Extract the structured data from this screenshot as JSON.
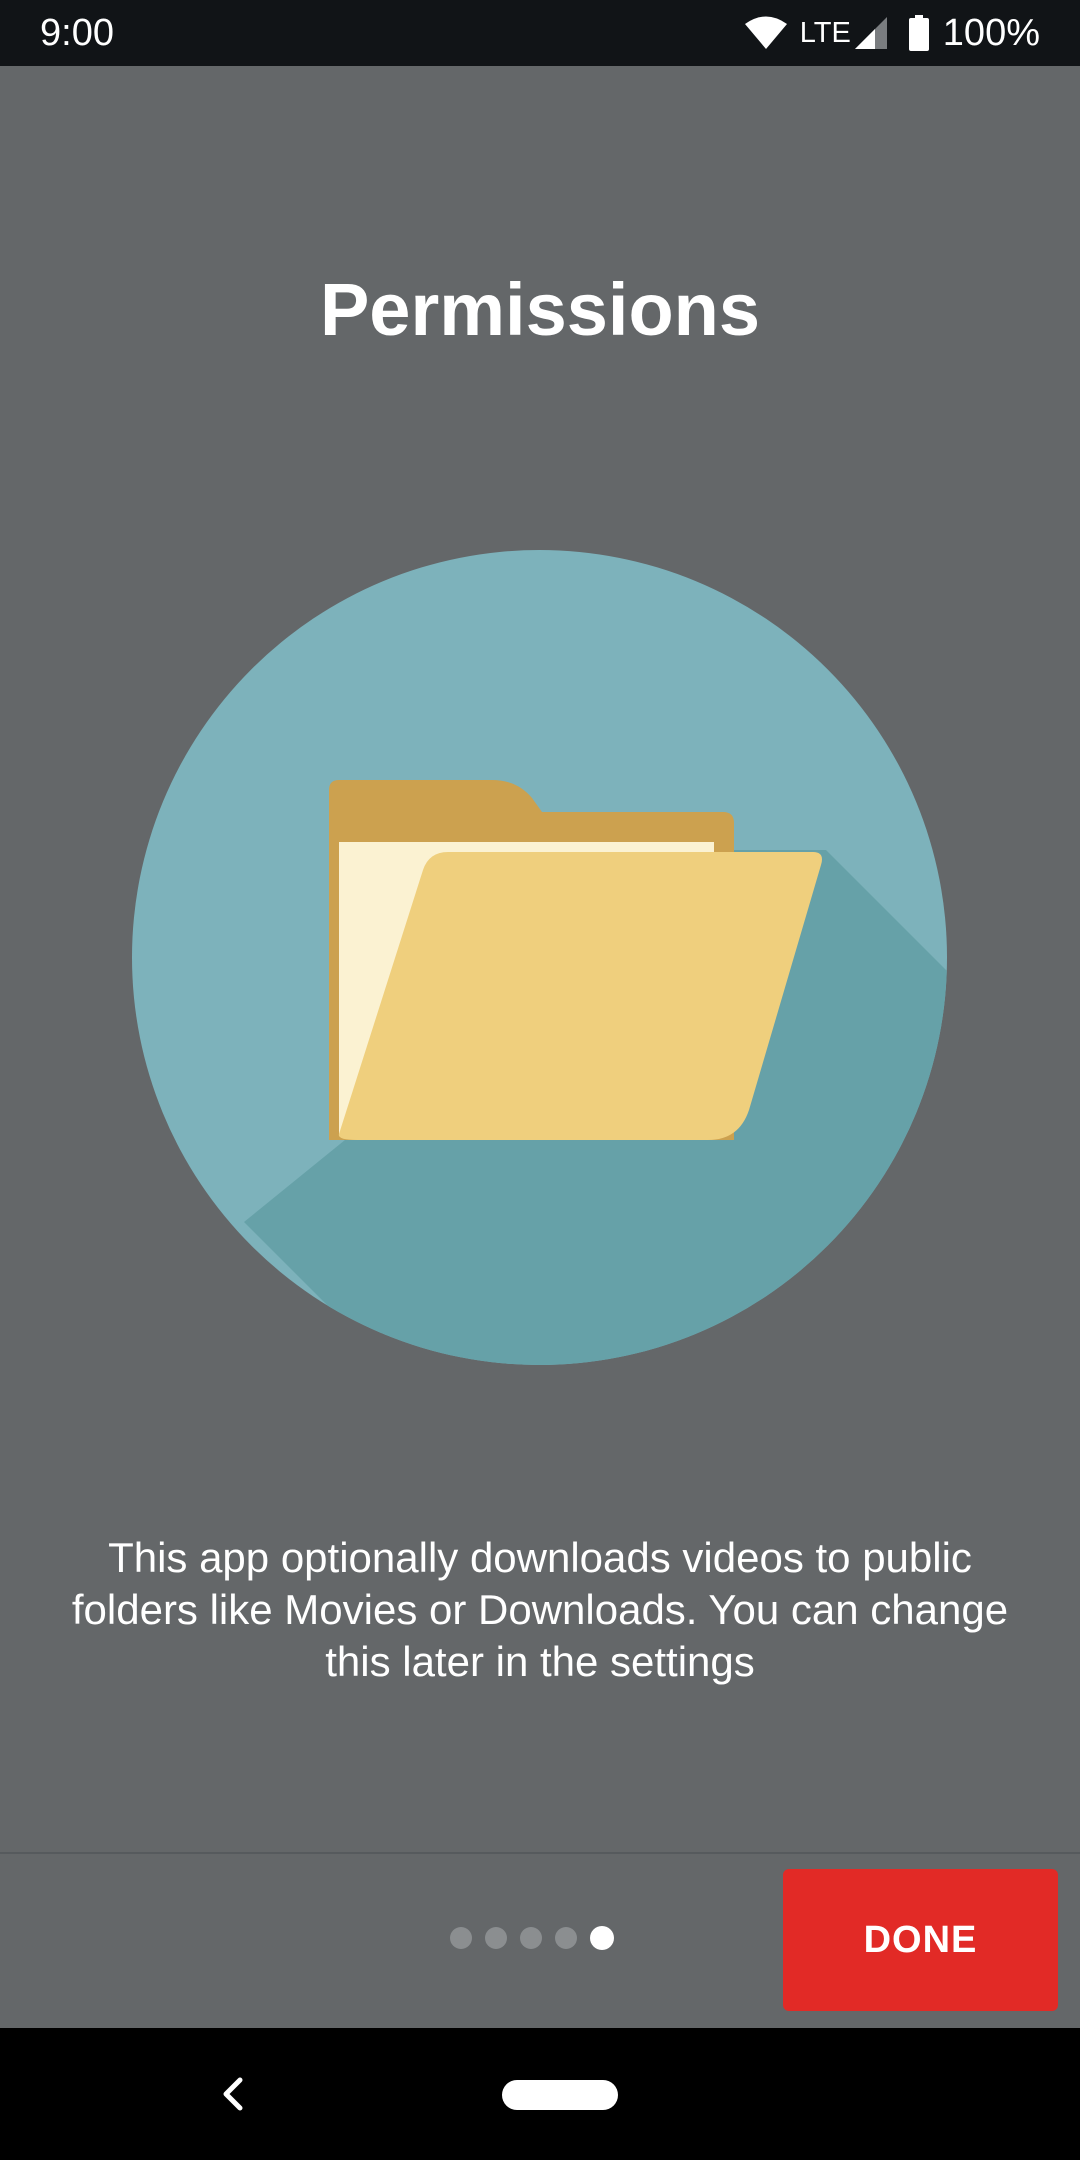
{
  "status_bar": {
    "time": "9:00",
    "network": "LTE",
    "battery": "100%",
    "icons": [
      "wifi-icon",
      "cell-signal-icon",
      "battery-icon"
    ]
  },
  "page": {
    "title": "Permissions",
    "illustration": "folder-icon",
    "description": "This app optionally downloads videos to public folders like Movies or Downloads. You can change this later in the settings"
  },
  "pager": {
    "total": 5,
    "current": 5
  },
  "footer": {
    "done_label": "DONE"
  },
  "nav_bar": {
    "icons": [
      "back-icon",
      "home-pill-icon"
    ]
  },
  "colors": {
    "background": "#646769",
    "status_bar": "#111417",
    "circle": "#7db2bb",
    "circle_shadow": "#66a1a8",
    "folder_back": "#cca14f",
    "folder_paper": "#fbf2d2",
    "folder_front": "#efcf7d",
    "done_button": "#e22a26",
    "nav_bar": "#000000"
  }
}
